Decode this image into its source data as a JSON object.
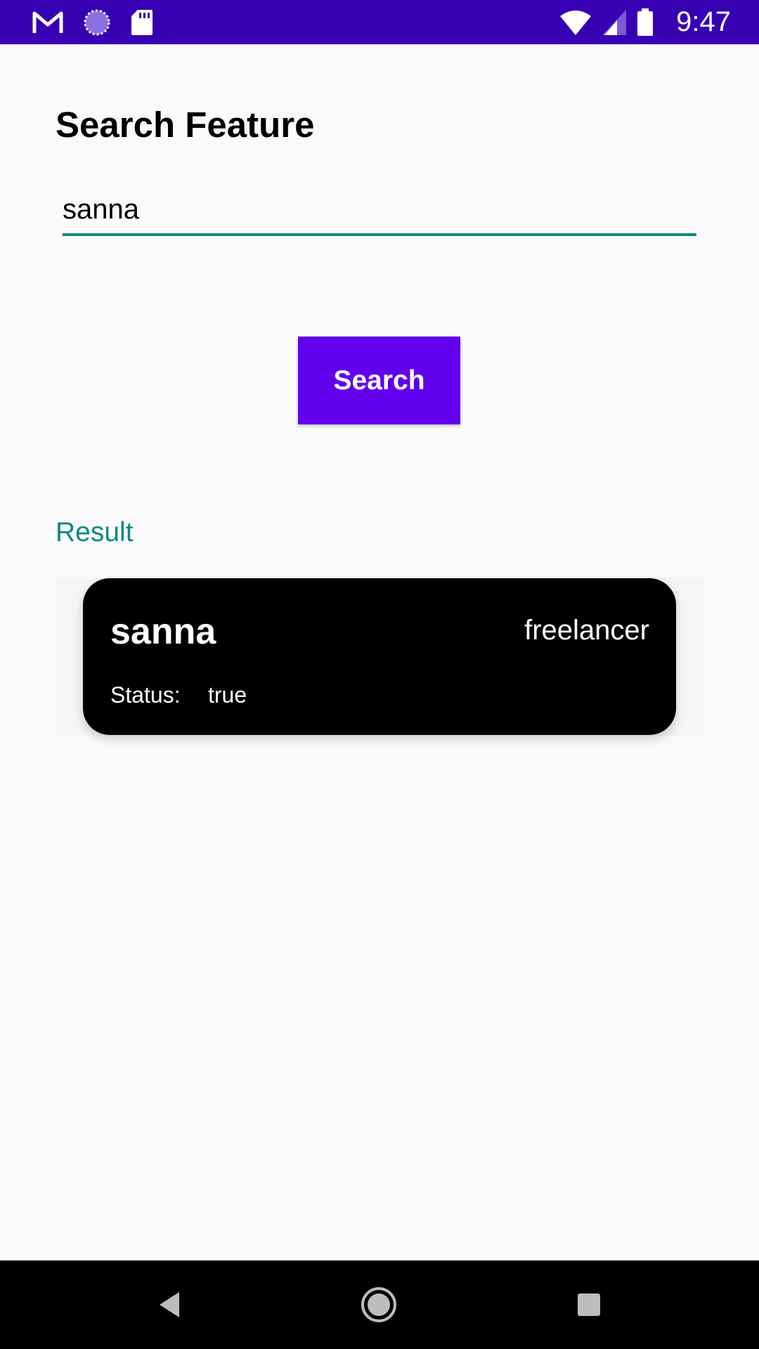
{
  "status_bar": {
    "time": "9:47",
    "background_color": "#3700b3",
    "icons_left": [
      "gmail-icon",
      "sync-icon",
      "sd-card-icon"
    ],
    "icons_right": [
      "wifi-icon",
      "signal-icon",
      "battery-icon"
    ]
  },
  "page": {
    "title": "Search Feature"
  },
  "search": {
    "value": "sanna",
    "accent_color": "#0a8a80"
  },
  "search_button": {
    "label": "Search",
    "color": "#6200ee"
  },
  "result": {
    "label": "Result",
    "card": {
      "name": "sanna",
      "role": "freelancer",
      "status_label": "Status:",
      "status_value": "true"
    }
  },
  "nav_bar": {
    "icons": [
      "back-icon",
      "home-icon",
      "recents-icon"
    ]
  }
}
